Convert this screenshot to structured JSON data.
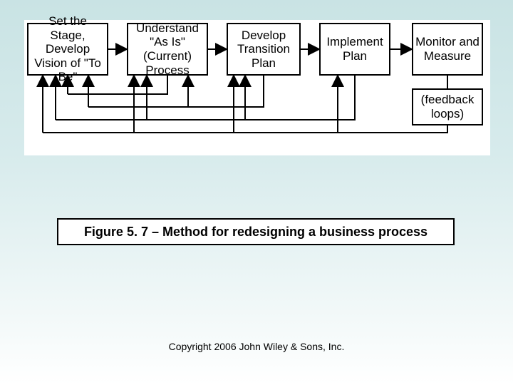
{
  "diagram": {
    "boxes": [
      "Set the Stage, Develop Vision of \"To Be\"",
      "Understand \"As Is\" (Current) Process",
      "Develop Transition Plan",
      "Implement Plan",
      "Monitor and Measure"
    ],
    "feedback_label": "(feedback loops)"
  },
  "caption": "Figure 5. 7 – Method for redesigning a business process",
  "copyright": "Copyright 2006 John Wiley & Sons, Inc."
}
